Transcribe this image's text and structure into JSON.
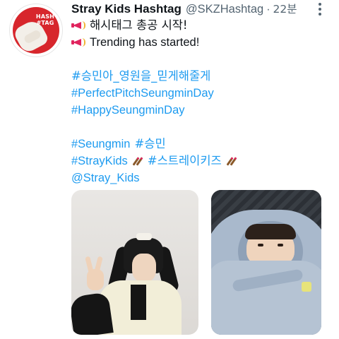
{
  "tweet": {
    "author_name": "Stray Kids Hashtag",
    "handle": "@SKZHashtag",
    "separator": "·",
    "time": "22분",
    "avatar_logo": [
      "HASH",
      "#TAG"
    ],
    "lines": {
      "announce_kr": "해시태그 총공 시작!",
      "announce_en": "Trending has started!",
      "tag1": "#승민아_영원을_믿게해줄게",
      "tag2": "#PerfectPitchSeungminDay",
      "tag3": "#HappySeungminDay",
      "tag4a": "#Seungmin",
      "tag4b": "#승민",
      "tag5a": "#StrayKids",
      "tag5b": "#스트레이키즈",
      "mention": "@Stray_Kids"
    },
    "icons": {
      "announce": "megaphone-icon",
      "tag_emoji": "chopsticks-icon",
      "more": "more-icon"
    },
    "colors": {
      "hashtag": "#1d9bf0",
      "text": "#0f1419",
      "secondary": "#536471",
      "avatar_bg": "#d7262c"
    },
    "media_count": 2
  }
}
